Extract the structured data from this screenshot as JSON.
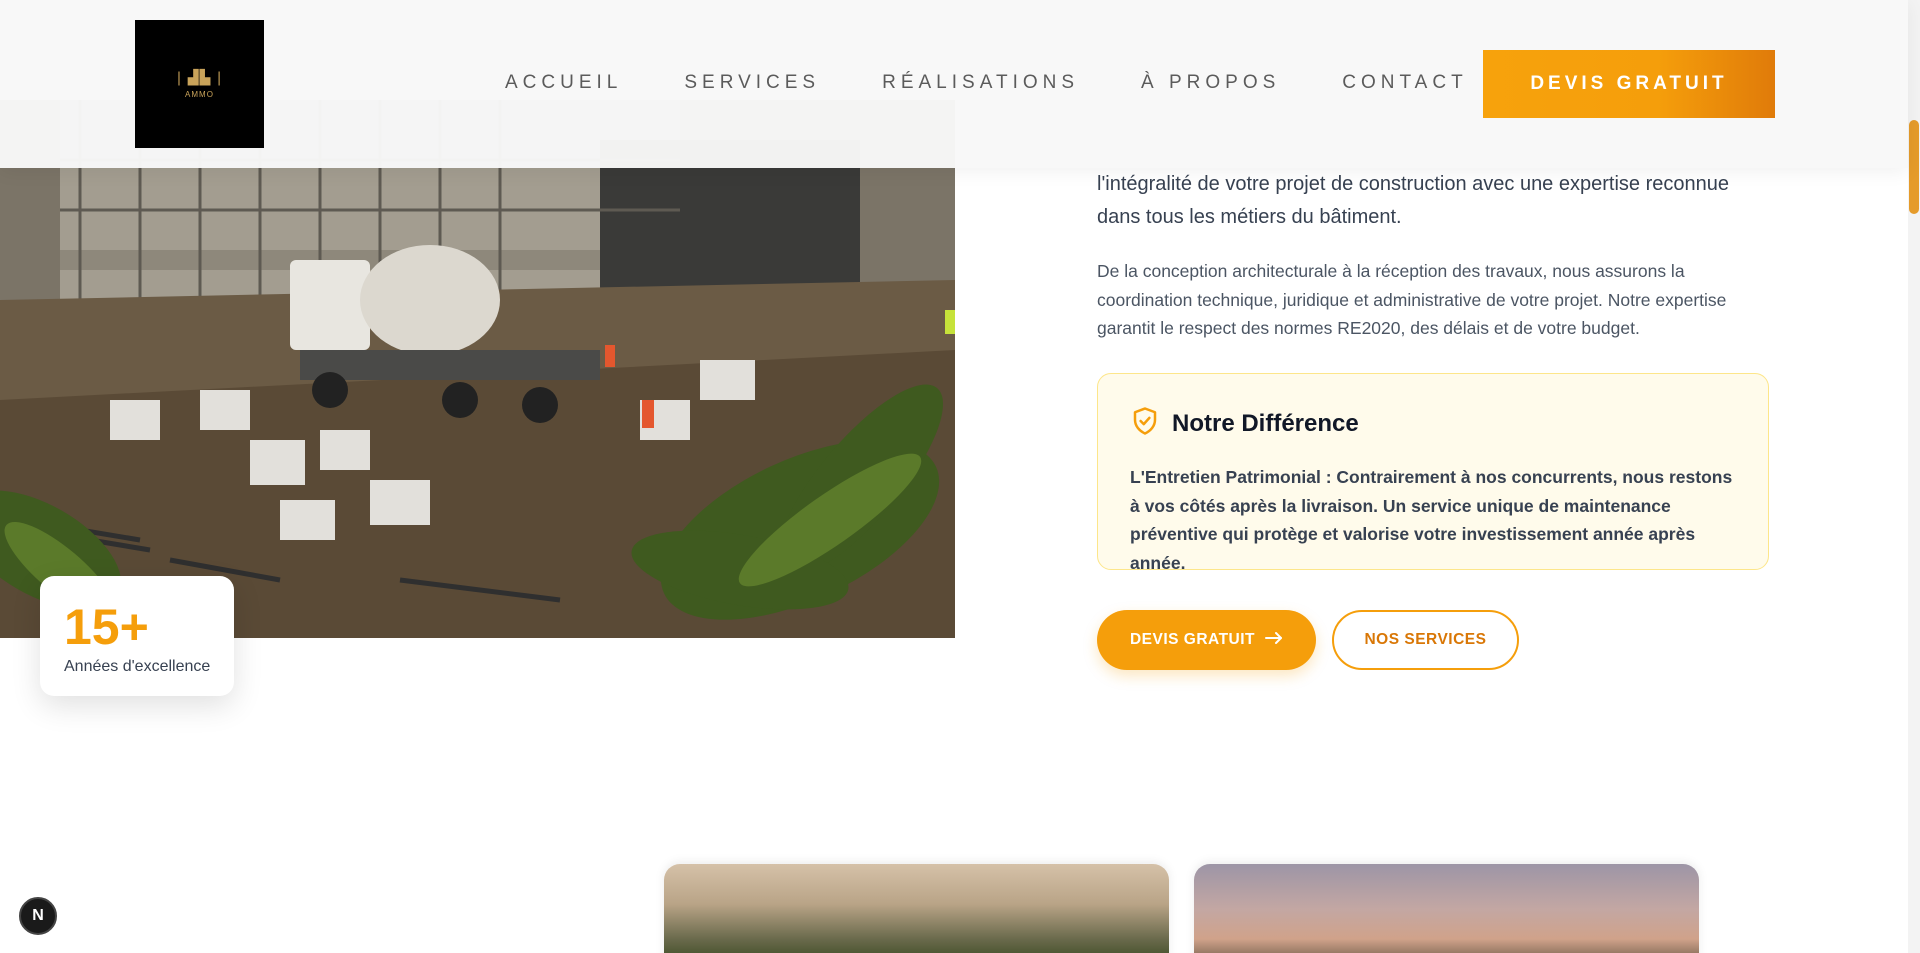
{
  "header": {
    "logo_text": "AMMO",
    "nav": [
      {
        "label": "ACCUEIL"
      },
      {
        "label": "SERVICES"
      },
      {
        "label": "RÉALISATIONS"
      },
      {
        "label": "À PROPOS"
      },
      {
        "label": "CONTACT"
      }
    ],
    "cta_label": "DEVIS GRATUIT"
  },
  "hero": {
    "stat_value": "15+",
    "stat_label": "Années d'excellence",
    "lead": "l'intégralité de votre projet de construction avec une expertise reconnue dans tous les métiers du bâtiment.",
    "body": "De la conception architecturale à la réception des travaux, nous assurons la coordination technique, juridique et administrative de votre projet. Notre expertise garantit le respect des normes RE2020, des délais et de votre budget.",
    "difference": {
      "title": "Notre Différence",
      "text": "L'Entretien Patrimonial : Contrairement à nos concurrents, nous restons à vos côtés après la livraison. Un service unique de maintenance préventive qui protège et valorise votre investissement année après année."
    },
    "primary_button": "DEVIS GRATUIT",
    "secondary_button": "NOS SERVICES"
  },
  "floating_badge": "N",
  "colors": {
    "accent": "#f59e0b",
    "accent_dark": "#d97706",
    "highlight_bg": "#fffbeb",
    "highlight_border": "#fde68a"
  },
  "icons": {
    "difference_icon": "shield-check-icon",
    "arrow": "arrow-right-icon"
  }
}
